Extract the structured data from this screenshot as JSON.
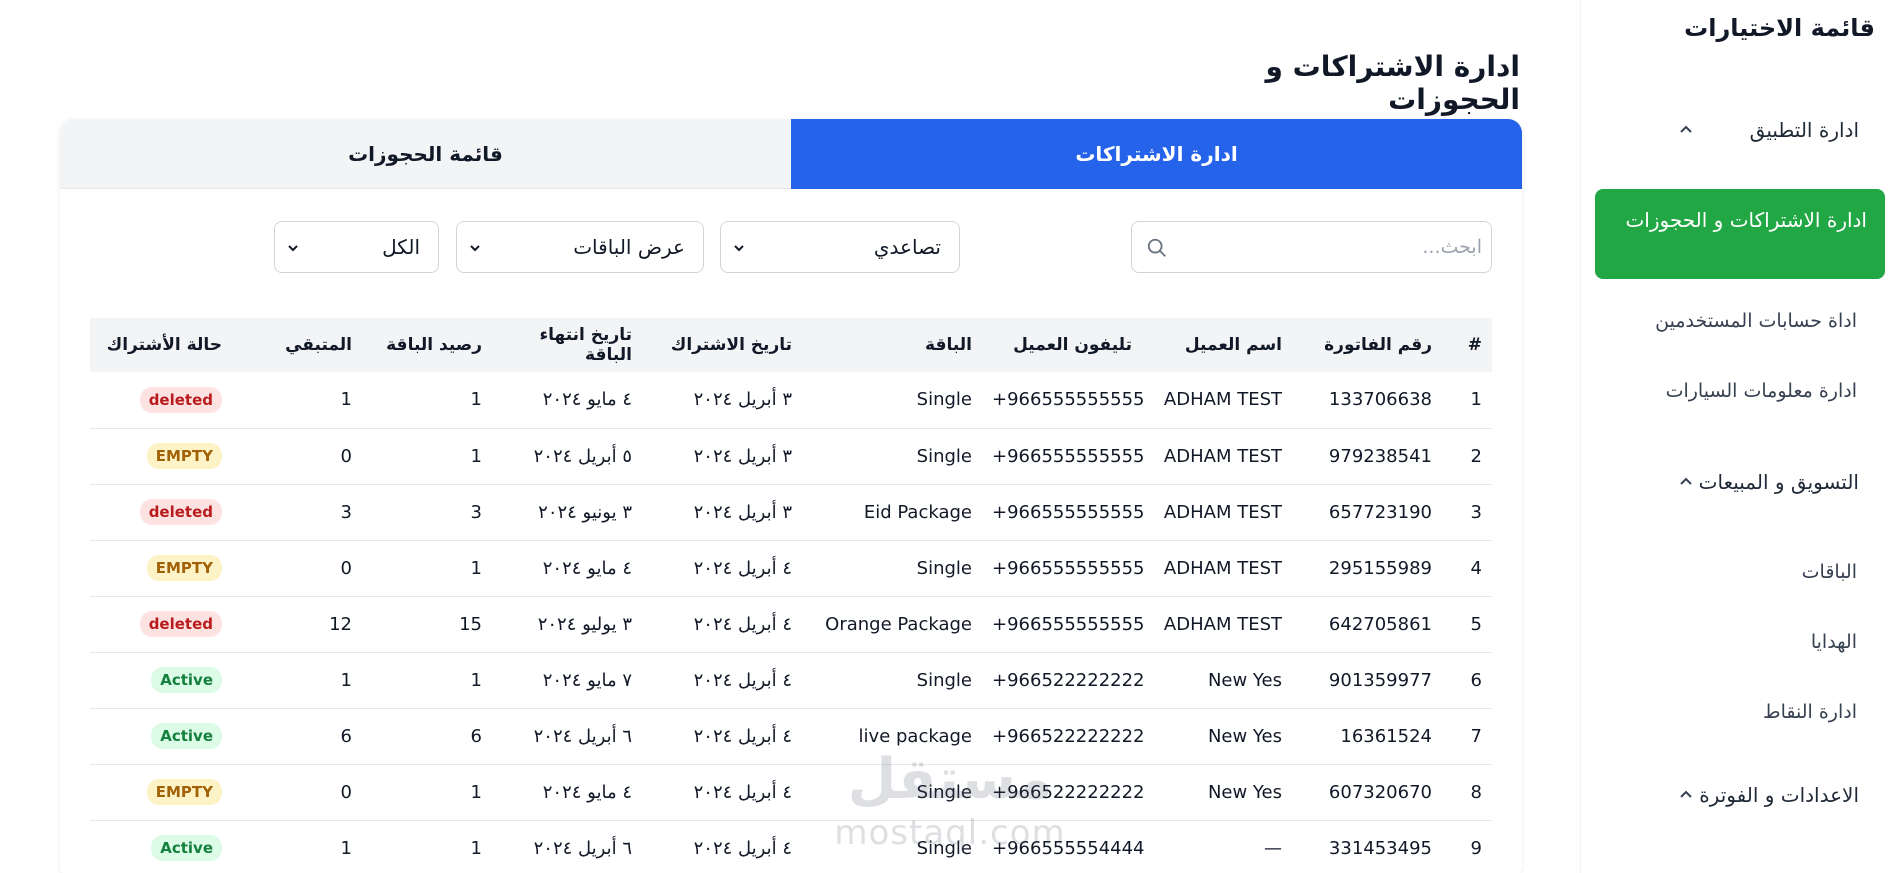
{
  "page_title": "ادارة الاشتراكات و الحجوزات",
  "tabs": [
    {
      "label": "قائمة الحجوزات",
      "active": false
    },
    {
      "label": "ادارة الاشتراكات",
      "active": true
    }
  ],
  "filters": {
    "search_placeholder": "ابحث...",
    "sort_value": "تصاعدي",
    "packages_value": "عرض الباقات",
    "status_value": "الكل"
  },
  "table": {
    "headers": [
      "#",
      "رقم الفاتورة",
      "اسم العميل",
      "تليفون العميل",
      "الباقة",
      "تاريخ الاشتراك",
      "تاريخ انتهاء الباقة",
      "رصيد الباقة",
      "المتبقي",
      "حالة الأشتراك"
    ],
    "rows": [
      {
        "num": "1",
        "invoice": "133706638",
        "name": "ADHAM TEST",
        "phone": "+966555555555",
        "package": "Single",
        "start": "٣ أبريل ٢٠٢٤",
        "end": "٤ مايو ٢٠٢٤",
        "balance": "1",
        "remaining": "1",
        "status": "deleted"
      },
      {
        "num": "2",
        "invoice": "979238541",
        "name": "ADHAM TEST",
        "phone": "+966555555555",
        "package": "Single",
        "start": "٣ أبريل ٢٠٢٤",
        "end": "٥ أبريل ٢٠٢٤",
        "balance": "1",
        "remaining": "0",
        "status": "EMPTY"
      },
      {
        "num": "3",
        "invoice": "657723190",
        "name": "ADHAM TEST",
        "phone": "+966555555555",
        "package": "Eid Package",
        "start": "٣ أبريل ٢٠٢٤",
        "end": "٣ يونيو ٢٠٢٤",
        "balance": "3",
        "remaining": "3",
        "status": "deleted"
      },
      {
        "num": "4",
        "invoice": "295155989",
        "name": "ADHAM TEST",
        "phone": "+966555555555",
        "package": "Single",
        "start": "٤ أبريل ٢٠٢٤",
        "end": "٤ مايو ٢٠٢٤",
        "balance": "1",
        "remaining": "0",
        "status": "EMPTY"
      },
      {
        "num": "5",
        "invoice": "642705861",
        "name": "ADHAM TEST",
        "phone": "+966555555555",
        "package": "Orange Package",
        "start": "٤ أبريل ٢٠٢٤",
        "end": "٣ يوليو ٢٠٢٤",
        "balance": "15",
        "remaining": "12",
        "status": "deleted"
      },
      {
        "num": "6",
        "invoice": "901359977",
        "name": "New Yes",
        "phone": "+966522222222",
        "package": "Single",
        "start": "٤ أبريل ٢٠٢٤",
        "end": "٧ مايو ٢٠٢٤",
        "balance": "1",
        "remaining": "1",
        "status": "Active"
      },
      {
        "num": "7",
        "invoice": "16361524",
        "name": "New Yes",
        "phone": "+966522222222",
        "package": "live package",
        "start": "٤ أبريل ٢٠٢٤",
        "end": "٦ أبريل ٢٠٢٤",
        "balance": "6",
        "remaining": "6",
        "status": "Active"
      },
      {
        "num": "8",
        "invoice": "607320670",
        "name": "New Yes",
        "phone": "+966522222222",
        "package": "Single",
        "start": "٤ أبريل ٢٠٢٤",
        "end": "٤ مايو ٢٠٢٤",
        "balance": "1",
        "remaining": "0",
        "status": "EMPTY"
      },
      {
        "num": "9",
        "invoice": "331453495",
        "name": "—",
        "phone": "+966555554444",
        "package": "Single",
        "start": "٤ أبريل ٢٠٢٤",
        "end": "٦ أبريل ٢٠٢٤",
        "balance": "1",
        "remaining": "1",
        "status": "Active"
      }
    ]
  },
  "sidebar": {
    "title": "قائمة الاختيارات",
    "sections": [
      {
        "label": "ادارة التطبيق",
        "expanded": true
      },
      {
        "label": "التسويق و المبيعات",
        "expanded": true
      },
      {
        "label": "الاعدادات و الفوترة",
        "expanded": true
      }
    ],
    "active_item": "ادارة الاشتراكات و الحجوزات",
    "items": [
      "اداة حسابات المستخدمين",
      "ادارة معلومات السيارات",
      "الباقات",
      "الهدايا",
      "ادارة النقاط"
    ]
  },
  "watermark": {
    "arabic": "مستقل",
    "latin": "mostaql.com"
  },
  "colors": {
    "primary_blue": "#2563eb",
    "active_green": "#22a745",
    "deleted_bg": "#fde2e2",
    "empty_bg": "#fef3c7",
    "active_bg": "#dcfce7"
  }
}
